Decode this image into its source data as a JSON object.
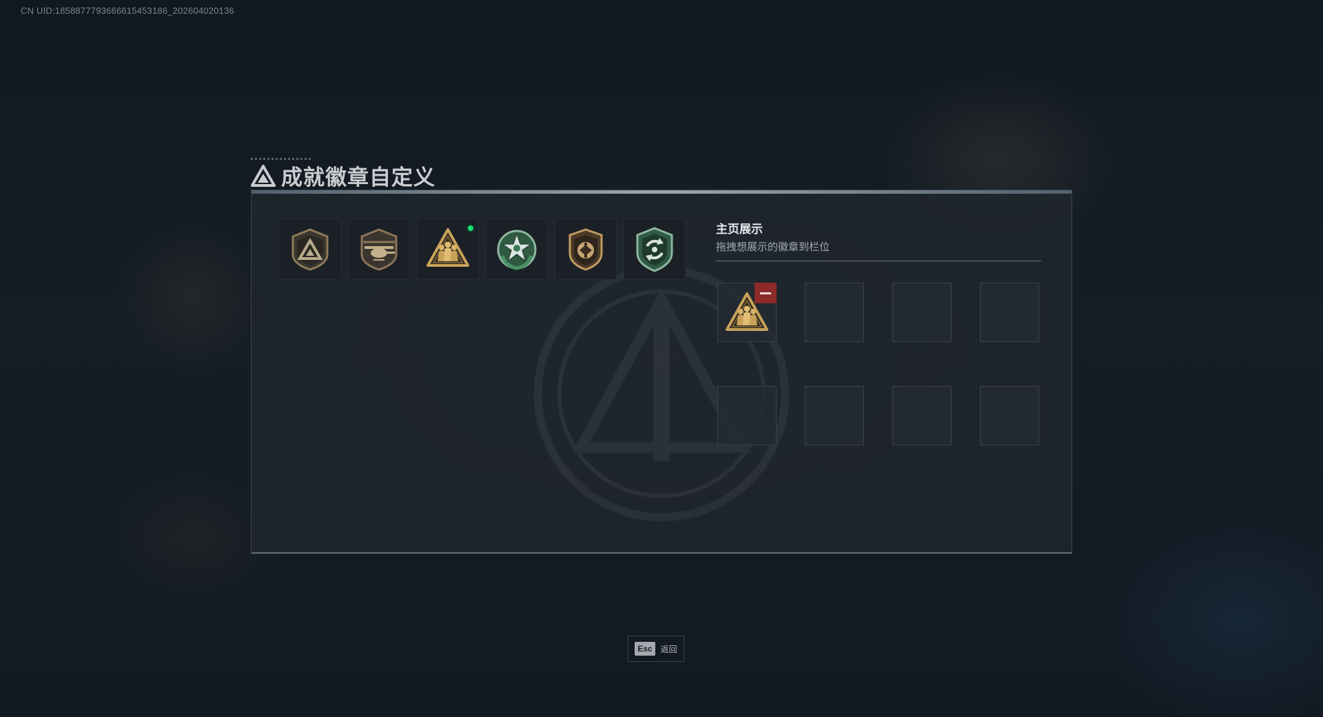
{
  "uid_text": "CN UID:1858877793666615453186_202604020136",
  "page": {
    "title": "成就徽章自定义",
    "title_icon": "delta-triangle-icon"
  },
  "badges": [
    {
      "icon": "triangle-shield-badge-icon",
      "new": false
    },
    {
      "icon": "helicopter-shield-badge-icon",
      "new": false
    },
    {
      "icon": "soldiers-triangle-badge-icon",
      "new": true
    },
    {
      "icon": "star-wreath-badge-icon",
      "new": false
    },
    {
      "icon": "eagle-shield-badge-icon",
      "new": false
    },
    {
      "icon": "recycle-shield-badge-icon",
      "new": false
    }
  ],
  "showcase": {
    "title": "主页展示",
    "subtitle": "拖拽想展示的徽章到栏位",
    "slots": [
      {
        "icon": "soldiers-triangle-badge-icon",
        "filled": true
      },
      {
        "filled": false
      },
      {
        "filled": false
      },
      {
        "filled": false
      },
      {
        "filled": false
      },
      {
        "filled": false
      },
      {
        "filled": false
      },
      {
        "filled": false
      }
    ]
  },
  "footer": {
    "key": "Esc",
    "label": "返回"
  },
  "colors": {
    "accent_gold": "#c9a25a",
    "new_dot": "#1ddc78",
    "remove_red": "#8d2b2b",
    "green_badge": "#3d7a55"
  }
}
